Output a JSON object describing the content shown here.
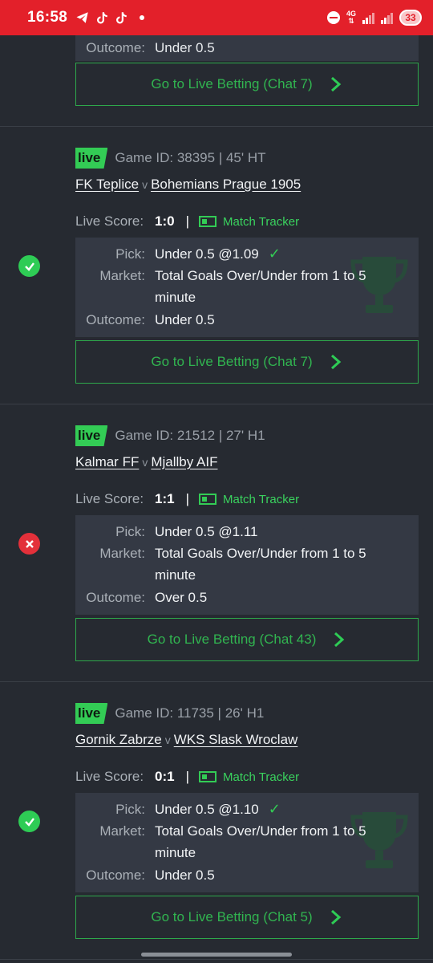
{
  "status_bar": {
    "time": "16:58",
    "network": "4G",
    "battery": "33"
  },
  "partial_card": {
    "outcome_label": "Outcome:",
    "outcome_value": "Under 0.5",
    "button_label": "Go to Live Betting (Chat 7)"
  },
  "cards": [
    {
      "result": "win",
      "live_label": "live",
      "game_id": "Game ID: 38395 | 45' HT",
      "home_team": "FK Teplice",
      "vs": "v",
      "away_team": "Bohemians Prague 1905",
      "score_label": "Live Score:",
      "score": "1:0",
      "separator": "|",
      "tracker_label": "Match Tracker",
      "pick_label": "Pick:",
      "pick_value": "Under 0.5 @1.09",
      "pick_checked": true,
      "market_label": "Market:",
      "market_value": "Total Goals Over/Under from 1 to 5 minute",
      "outcome_label": "Outcome:",
      "outcome_value": "Under 0.5",
      "button_label": "Go to Live Betting (Chat 7)"
    },
    {
      "result": "loss",
      "live_label": "live",
      "game_id": "Game ID: 21512 | 27' H1",
      "home_team": "Kalmar FF",
      "vs": "v",
      "away_team": "Mjallby AIF",
      "score_label": "Live Score:",
      "score": "1:1",
      "separator": "|",
      "tracker_label": "Match Tracker",
      "pick_label": "Pick:",
      "pick_value": "Under 0.5 @1.11",
      "pick_checked": false,
      "market_label": "Market:",
      "market_value": "Total Goals Over/Under from 1 to 5 minute",
      "outcome_label": "Outcome:",
      "outcome_value": "Over 0.5",
      "button_label": "Go to Live Betting (Chat 43)"
    },
    {
      "result": "win",
      "live_label": "live",
      "game_id": "Game ID: 11735 | 26' H1",
      "home_team": "Gornik Zabrze",
      "vs": "v",
      "away_team": "WKS Slask Wroclaw",
      "score_label": "Live Score:",
      "score": "0:1",
      "separator": "|",
      "tracker_label": "Match Tracker",
      "pick_label": "Pick:",
      "pick_value": "Under 0.5 @1.10",
      "pick_checked": true,
      "market_label": "Market:",
      "market_value": "Total Goals Over/Under from 1 to 5 minute",
      "outcome_label": "Outcome:",
      "outcome_value": "Under 0.5",
      "button_label": "Go to Live Betting (Chat 5)"
    }
  ],
  "colors": {
    "accent_green": "#33cc55",
    "loss_red": "#e3303a",
    "status_bar": "#e3202a",
    "background": "#262a31"
  }
}
